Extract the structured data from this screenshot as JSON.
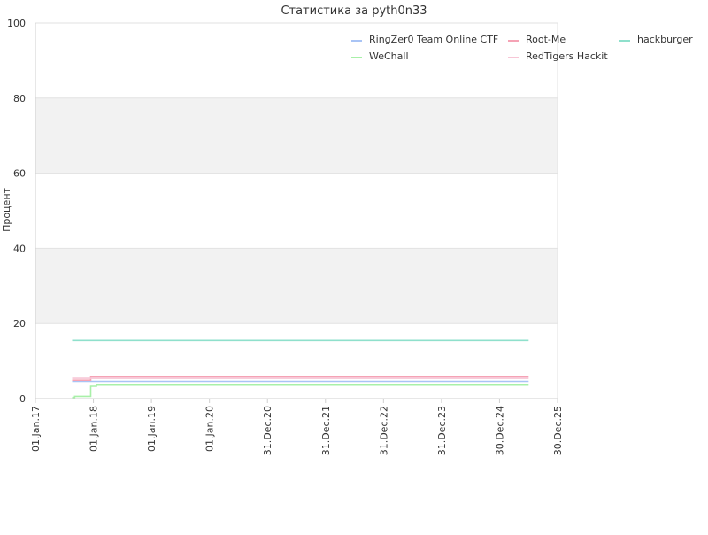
{
  "chart_data": {
    "type": "line",
    "title": "Статистика за pyth0n33",
    "xlabel": "",
    "ylabel": "Процент",
    "ylim": [
      0,
      100
    ],
    "yticks": [
      0,
      20,
      40,
      60,
      80,
      100
    ],
    "xlim": [
      "2017-01-01",
      "2025-12-30"
    ],
    "xticks": [
      {
        "date": "2017-01-01",
        "label": "01.Jan.17"
      },
      {
        "date": "2018-01-01",
        "label": "01.Jan.18"
      },
      {
        "date": "2019-01-01",
        "label": "01.Jan.19"
      },
      {
        "date": "2020-01-01",
        "label": "01.Jan.20"
      },
      {
        "date": "2020-12-31",
        "label": "31.Dec.20"
      },
      {
        "date": "2021-12-31",
        "label": "31.Dec.21"
      },
      {
        "date": "2022-12-31",
        "label": "31.Dec.22"
      },
      {
        "date": "2023-12-31",
        "label": "31.Dec.23"
      },
      {
        "date": "2024-12-30",
        "label": "30.Dec.24"
      },
      {
        "date": "2025-12-30",
        "label": "30.Dec.25"
      }
    ],
    "grid": "horizontal alternating bands",
    "legend_position": "top-right",
    "series": [
      {
        "name": "RingZer0 Team Online CTF",
        "color": "#a9c4f5",
        "points": [
          [
            "2017-08-20",
            4.6
          ],
          [
            "2025-07-01",
            4.6
          ]
        ]
      },
      {
        "name": "WeChall",
        "color": "#a8f0a8",
        "points": [
          [
            "2017-08-20",
            0.3
          ],
          [
            "2017-09-05",
            0.3
          ],
          [
            "2017-09-05",
            0.6
          ],
          [
            "2017-12-15",
            0.6
          ],
          [
            "2017-12-15",
            3.3
          ],
          [
            "2018-01-20",
            3.3
          ],
          [
            "2018-01-20",
            3.6
          ],
          [
            "2025-07-01",
            3.6
          ]
        ]
      },
      {
        "name": "Root-Me",
        "color": "#f5a3b5",
        "points": [
          [
            "2017-08-20",
            4.9
          ],
          [
            "2017-12-15",
            4.9
          ],
          [
            "2017-12-15",
            5.8
          ],
          [
            "2025-07-01",
            5.8
          ]
        ]
      },
      {
        "name": "RedTigers Hackit",
        "color": "#f7c6d6",
        "points": [
          [
            "2017-08-20",
            5.4
          ],
          [
            "2025-07-01",
            5.4
          ]
        ]
      },
      {
        "name": "hackburger",
        "color": "#8fe0cc",
        "points": [
          [
            "2017-08-20",
            15.5
          ],
          [
            "2025-07-01",
            15.5
          ]
        ]
      }
    ]
  }
}
